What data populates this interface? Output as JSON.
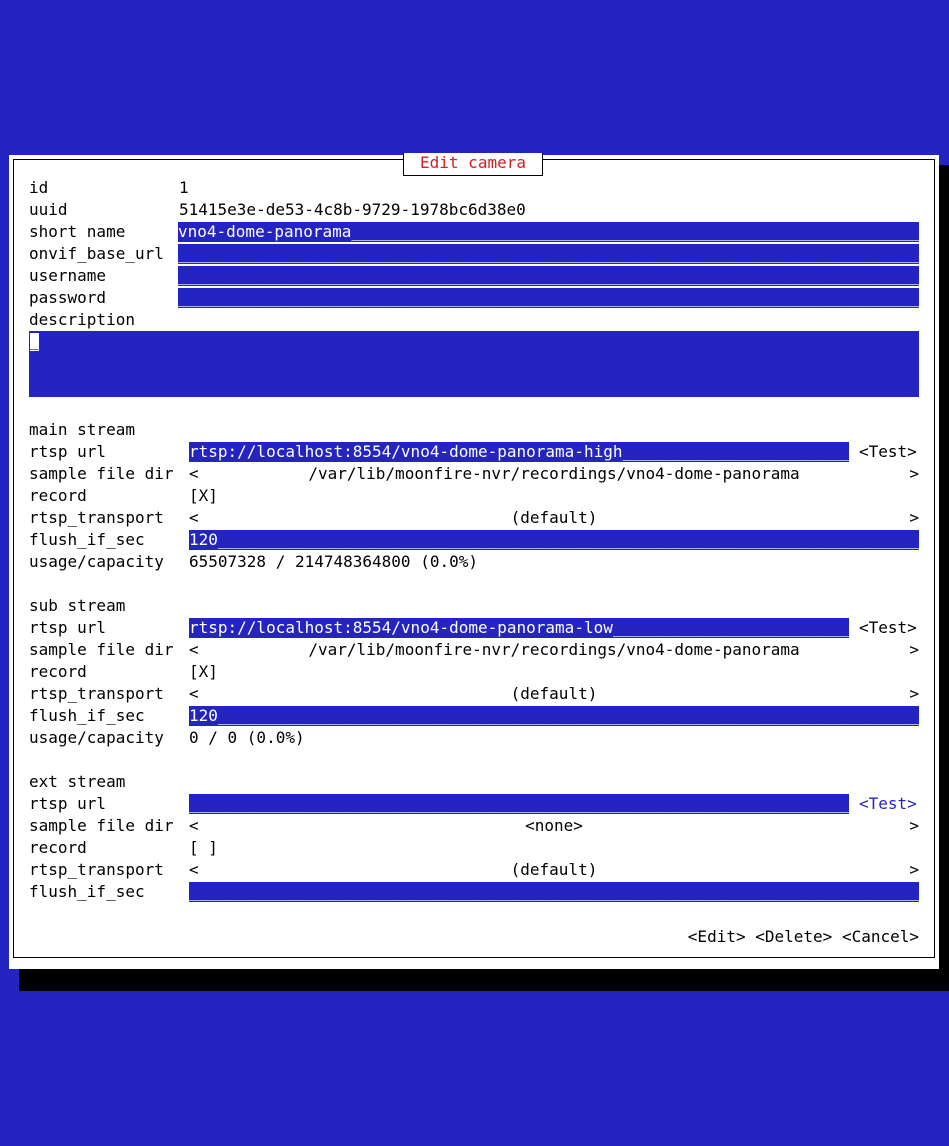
{
  "dialog": {
    "title": "Edit camera"
  },
  "camera": {
    "id_label": "id",
    "id": "1",
    "uuid_label": "uuid",
    "uuid": "51415e3e-de53-4c8b-9729-1978bc6d38e0",
    "short_name_label": "short name",
    "short_name": "vno4-dome-panorama",
    "onvif_label": "onvif_base_url",
    "onvif_base_url": "",
    "username_label": "username",
    "username": "",
    "password_label": "password",
    "password": "",
    "description_label": "description",
    "description": ""
  },
  "labels": {
    "rtsp_url": "rtsp url",
    "sample_file_dir": "sample file dir",
    "record": "record",
    "rtsp_transport": "rtsp_transport",
    "flush_if_sec": "flush_if_sec",
    "usage_capacity": "usage/capacity",
    "test": "<Test>",
    "prev": "<",
    "next": ">"
  },
  "streams": [
    {
      "heading": "main stream",
      "rtsp_url": "rtsp://localhost:8554/vno4-dome-panorama-high",
      "sample_file_dir": "/var/lib/moonfire-nvr/recordings/vno4-dome-panorama",
      "record": "[X]",
      "rtsp_transport": "(default)",
      "flush_if_sec": "120",
      "usage_capacity": "65507328 / 214748364800 (0.0%)"
    },
    {
      "heading": "sub stream",
      "rtsp_url": "rtsp://localhost:8554/vno4-dome-panorama-low",
      "sample_file_dir": "/var/lib/moonfire-nvr/recordings/vno4-dome-panorama",
      "record": "[X]",
      "rtsp_transport": "(default)",
      "flush_if_sec": "120",
      "usage_capacity": "0 / 0 (0.0%)"
    },
    {
      "heading": "ext stream",
      "rtsp_url": "",
      "sample_file_dir": "<none>",
      "record": "[ ]",
      "rtsp_transport": "(default)",
      "flush_if_sec": ""
    }
  ],
  "buttons": {
    "edit": "<Edit>",
    "delete": "<Delete>",
    "cancel": "<Cancel>"
  },
  "colors": {
    "background": "#2424c2",
    "dialog": "#ffffff",
    "title": "#d42020",
    "field": "#2424c2"
  }
}
